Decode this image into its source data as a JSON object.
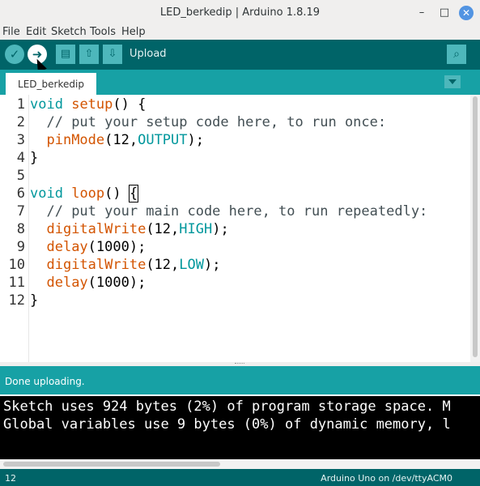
{
  "window": {
    "title": "LED_berkedip | Arduino 1.8.19",
    "minimize": "–",
    "maximize": "□",
    "close": "✕"
  },
  "menu": [
    "File",
    "Edit",
    "Sketch",
    "Tools",
    "Help"
  ],
  "toolbar": {
    "verify_icon": "check-icon",
    "upload_icon": "arrow-right-icon",
    "new_icon": "new-file-icon",
    "open_icon": "upload-arrow-icon",
    "save_icon": "download-arrow-icon",
    "status_label": "Upload",
    "serial_icon": "magnifier-icon"
  },
  "tab": {
    "name": "LED_berkedip"
  },
  "editor": {
    "line_numbers": [
      "1",
      "2",
      "3",
      "4",
      "5",
      "6",
      "7",
      "8",
      "9",
      "10",
      "11",
      "12"
    ]
  },
  "status": {
    "message": "Done uploading."
  },
  "console": {
    "lines": [
      "Sketch uses 924 bytes (2%) of program storage space. M",
      "Global variables use 9 bytes (0%) of dynamic memory, l"
    ]
  },
  "footer": {
    "line": "12",
    "board": "Arduino Uno on /dev/ttyACM0"
  }
}
